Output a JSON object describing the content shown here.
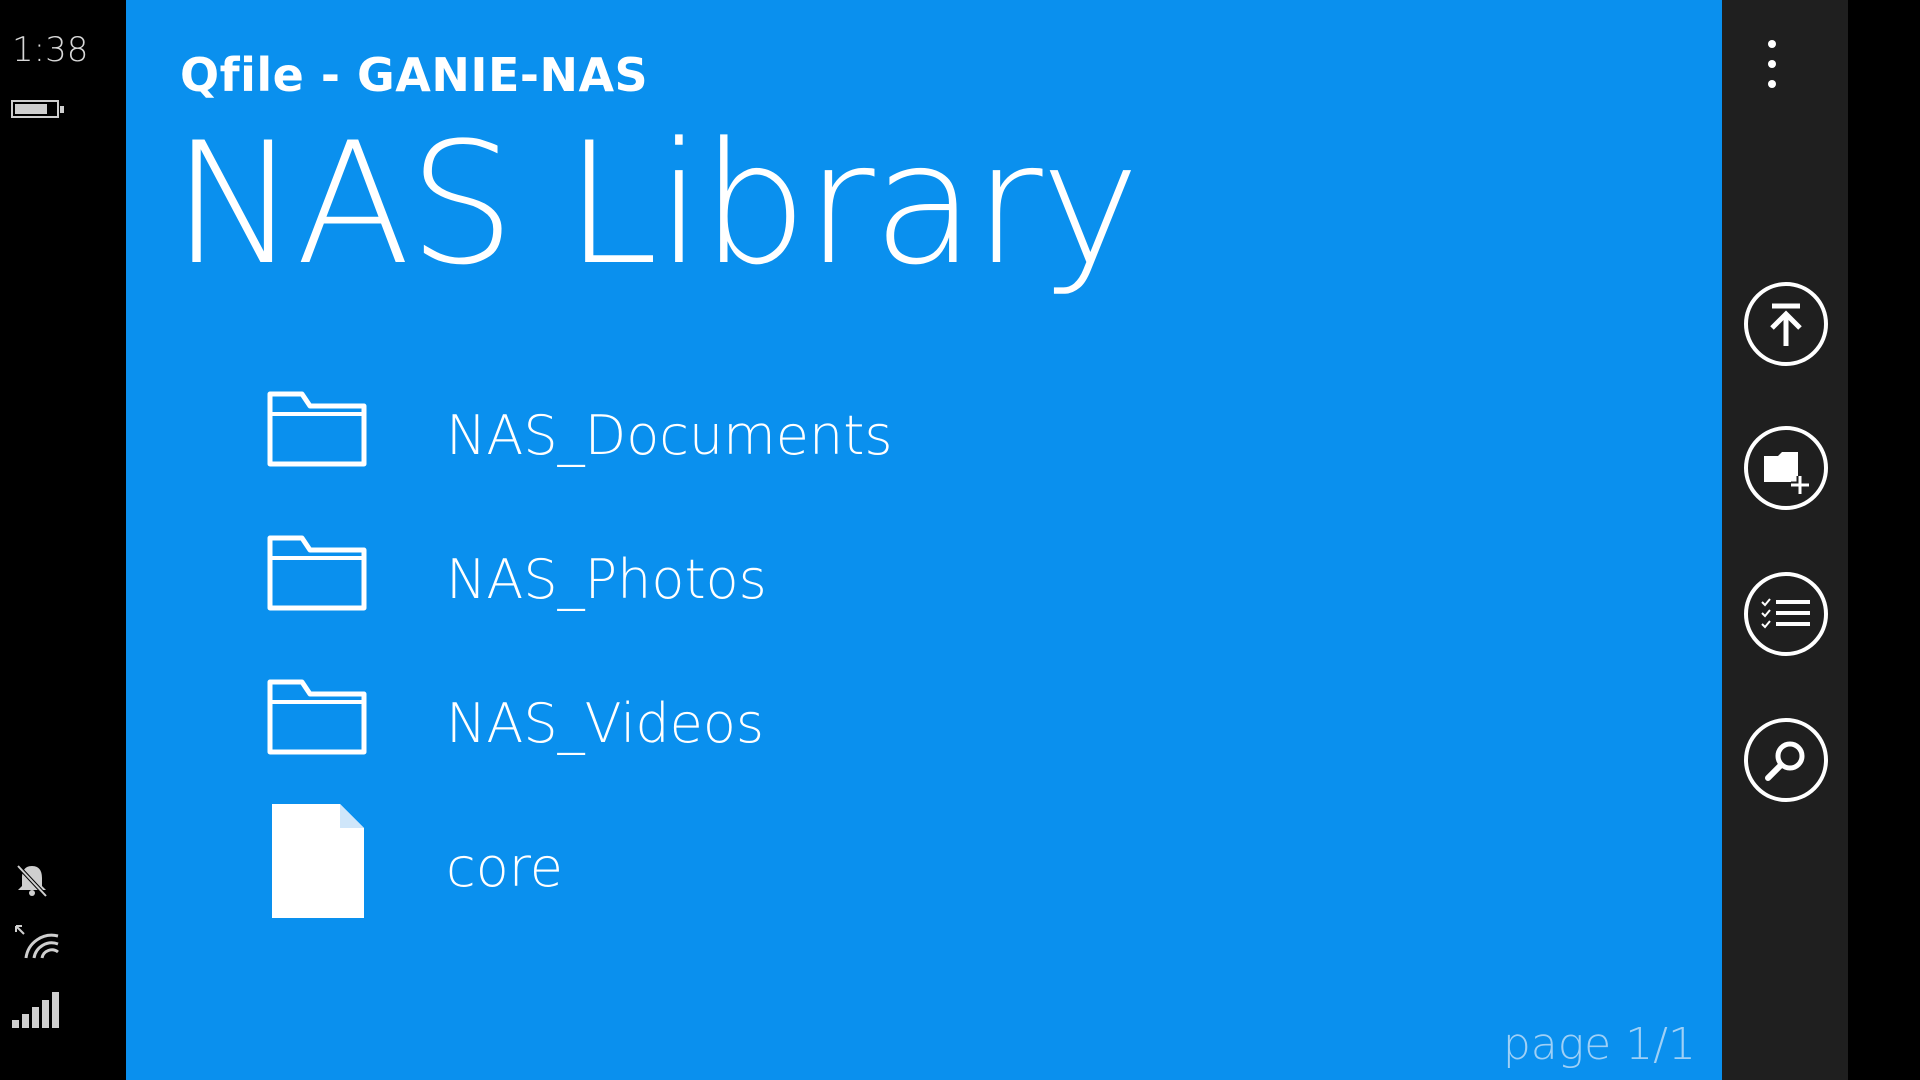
{
  "status": {
    "time": "1:38",
    "battery_level": 0.8
  },
  "header": {
    "app_title": "Qfile - GANIE-NAS",
    "page_title": "NAS Library"
  },
  "files": [
    {
      "name": "NAS_Documents",
      "type": "folder"
    },
    {
      "name": "NAS_Photos",
      "type": "folder"
    },
    {
      "name": "NAS_Videos",
      "type": "folder"
    },
    {
      "name": "core",
      "type": "file"
    }
  ],
  "pager": "page 1/1",
  "appbar": {
    "buttons": [
      "upload-icon",
      "new-folder-icon",
      "select-list-icon",
      "search-icon"
    ]
  },
  "colors": {
    "accent": "#0a90ee",
    "appbar": "#1f1f1f"
  }
}
